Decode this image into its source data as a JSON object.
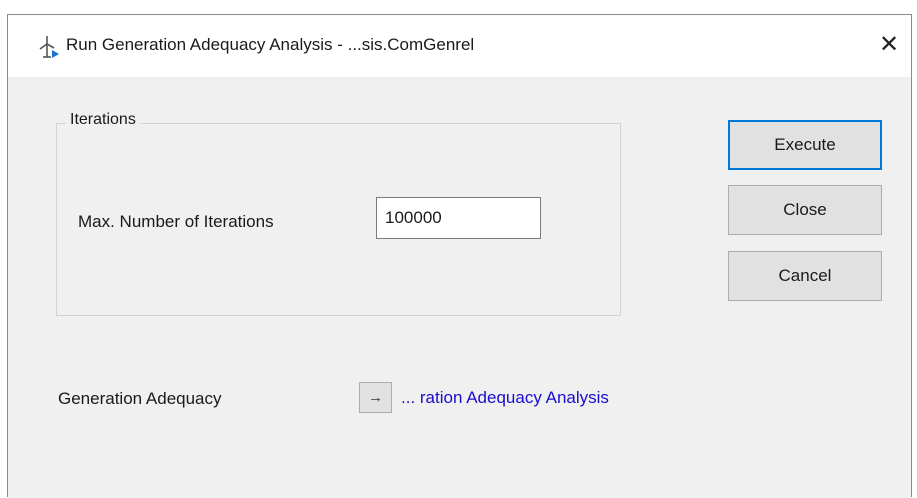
{
  "window": {
    "title": "Run Generation Adequacy Analysis - ...sis.ComGenrel",
    "close_glyph": "✕",
    "title_icon": "wind-turbine-icon"
  },
  "iterations_group": {
    "legend": "Iterations",
    "max_label": "Max. Number of Iterations",
    "max_value": "100000"
  },
  "buttons": {
    "execute": "Execute",
    "close": "Close",
    "cancel": "Cancel"
  },
  "reference": {
    "label": "Generation Adequacy",
    "arrow_glyph": "→",
    "link_text": "... ration Adequacy Analysis"
  },
  "colors": {
    "accent": "#0078d7",
    "link": "#1a0dcc",
    "dialog_bg": "#f0f0f0"
  }
}
